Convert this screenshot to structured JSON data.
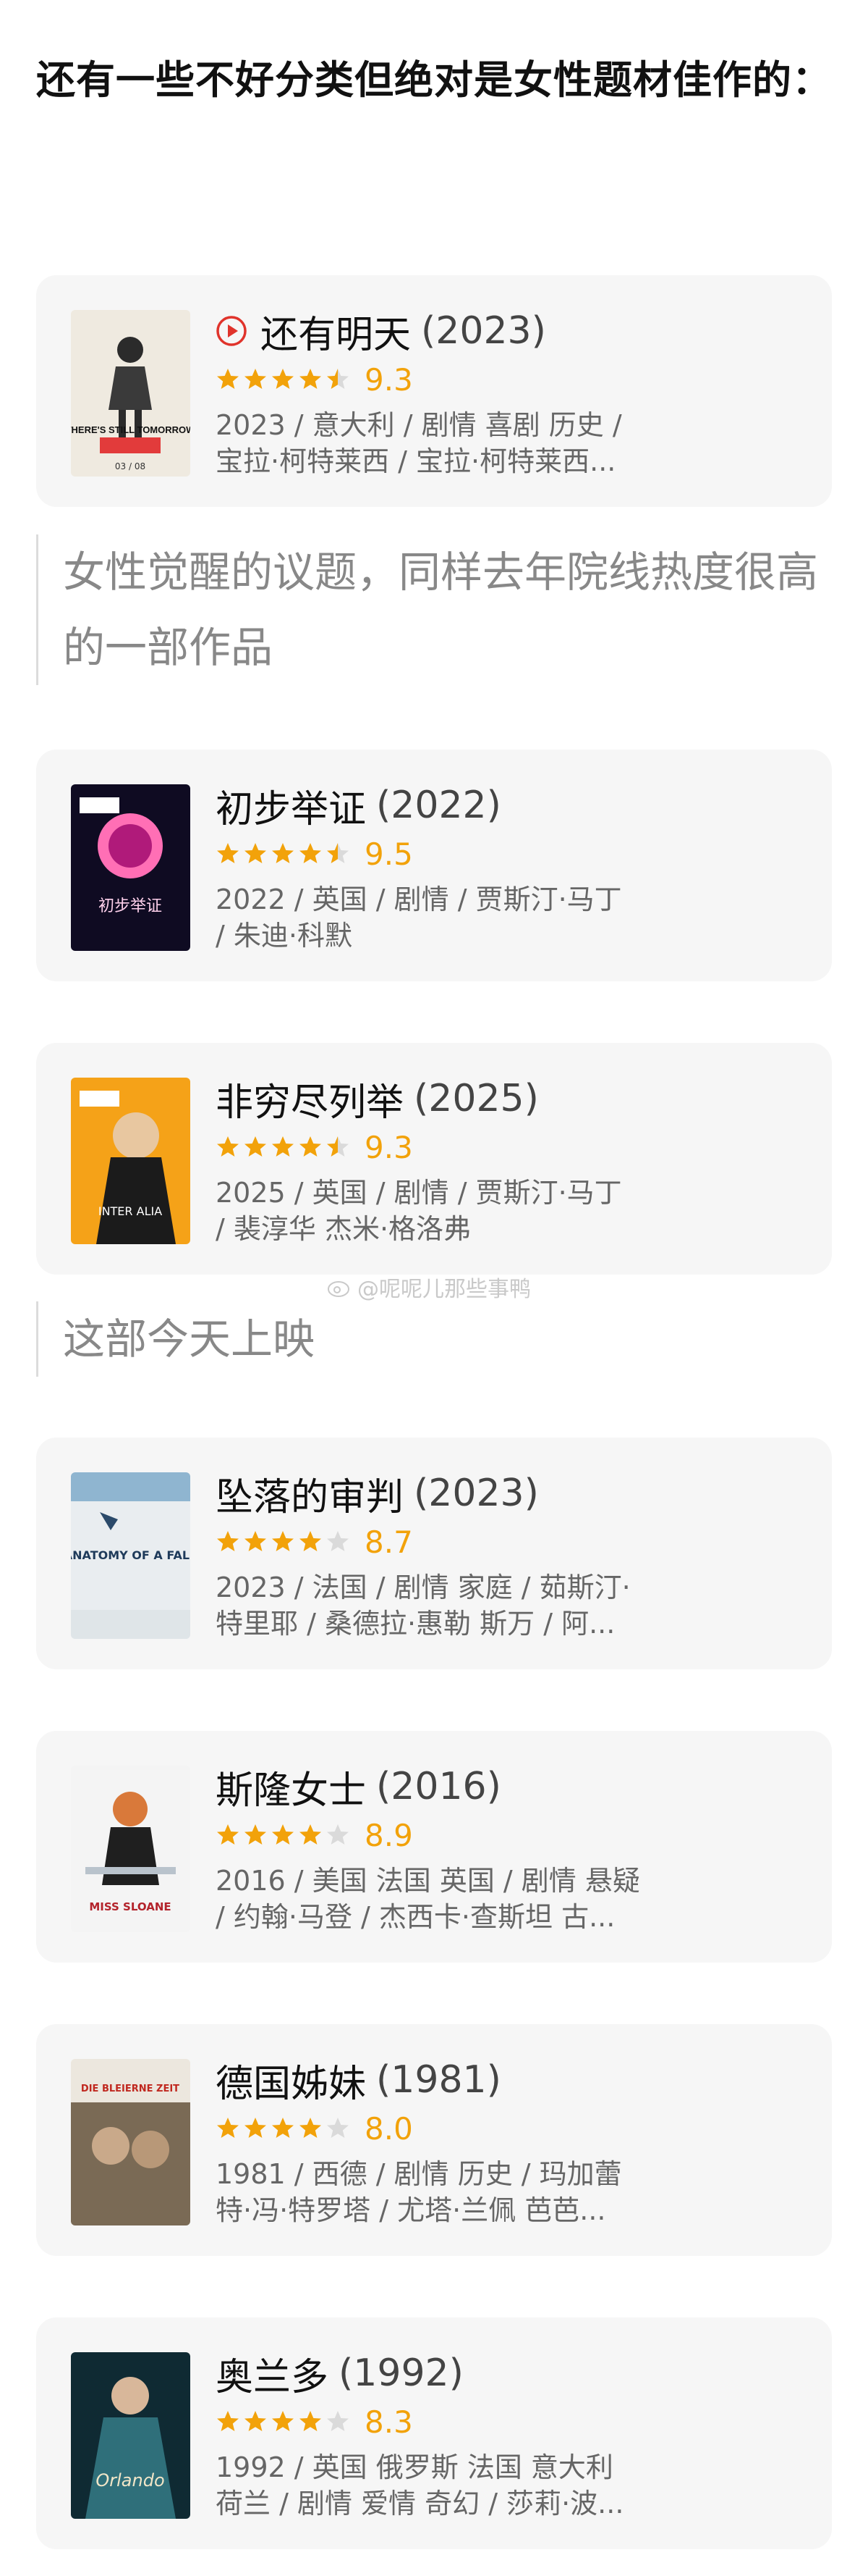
{
  "heading": "还有一些不好分类但绝对是女性题材佳作的：",
  "watermark": "@呢呢儿那些事鸭",
  "quotes": {
    "q1": "女性觉醒的议题，同样去年院线热度很高的一部作品",
    "q2": "这部今天上映"
  },
  "movies": [
    {
      "title": "还有明天",
      "year": "(2023)",
      "score": "9.3",
      "stars": 4.5,
      "line1": "2023 / 意大利 / 剧情 喜剧 历史 /",
      "line2": "宝拉·柯特莱西 / 宝拉·柯特莱西...",
      "poster_text": "THERE'S STILL TOMORROW",
      "play_icon": true
    },
    {
      "title": "初步举证",
      "year": "(2022)",
      "score": "9.5",
      "stars": 4.5,
      "line1": "2022 / 英国 / 剧情 / 贾斯汀·马丁",
      "line2": "/ 朱迪·科默",
      "poster_text": "初步举证"
    },
    {
      "title": "非穷尽列举",
      "year": "(2025)",
      "score": "9.3",
      "stars": 4.5,
      "line1": "2025 / 英国 / 剧情 / 贾斯汀·马丁",
      "line2": "/ 裴淳华 杰米·格洛弗",
      "poster_text": "INTER ALIA"
    },
    {
      "title": "坠落的审判",
      "year": "(2023)",
      "score": "8.7",
      "stars": 4,
      "line1": "2023 / 法国 / 剧情 家庭 / 茹斯汀·",
      "line2": "特里耶 / 桑德拉·惠勒 斯万 / 阿...",
      "poster_text": "ANATOMY OF A FALL"
    },
    {
      "title": "斯隆女士",
      "year": "(2016)",
      "score": "8.9",
      "stars": 4,
      "line1": "2016 / 美国 法国 英国 / 剧情 悬疑",
      "line2": "/ 约翰·马登 / 杰西卡·查斯坦 古...",
      "poster_text": "MISS SLOANE"
    },
    {
      "title": "德国姊妹",
      "year": "(1981)",
      "score": "8.0",
      "stars": 4,
      "line1": "1981 / 西德 / 剧情 历史 / 玛加蕾",
      "line2": "特·冯·特罗塔 / 尤塔·兰佩 芭芭...",
      "poster_text": "DIE BLEIERNE ZEIT"
    },
    {
      "title": "奥兰多",
      "year": "(1992)",
      "score": "8.3",
      "stars": 4,
      "line1": "1992 / 英国 俄罗斯 法国 意大利",
      "line2": "荷兰 / 剧情 爱情 奇幻 / 莎莉·波...",
      "poster_text": "Orlando"
    }
  ]
}
